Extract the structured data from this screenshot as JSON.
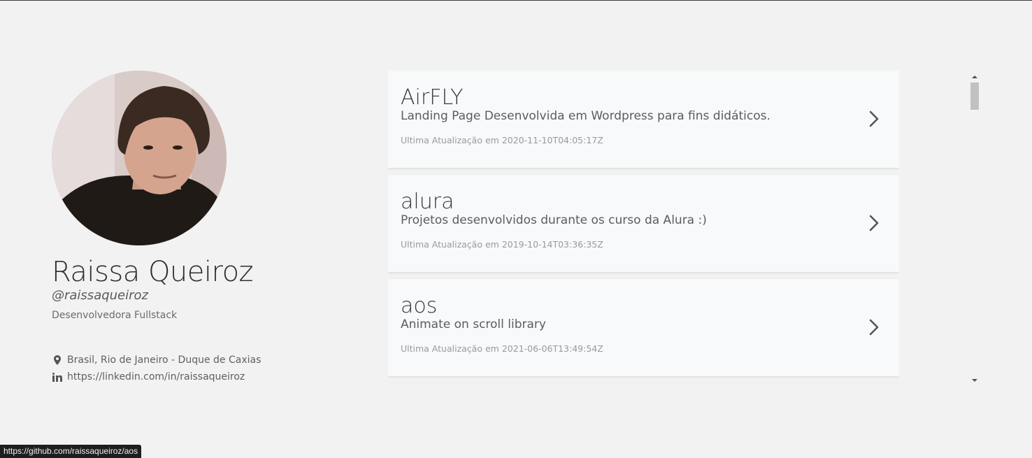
{
  "profile": {
    "name": "Raissa Queiroz",
    "handle": "@raissaqueiroz",
    "role": "Desenvolvedora Fullstack",
    "location": "Brasil, Rio de Janeiro - Duque de Caxias",
    "linkedin": "https://linkedin.com/in/raissaqueiroz",
    "location_icon": "map-marker-icon",
    "linkedin_icon": "linkedin-icon"
  },
  "repos": [
    {
      "title": "AirFLY",
      "description": "Landing Page Desenvolvida em Wordpress para fins didáticos.",
      "updated_label": "Ultima Atualização em",
      "updated_at": "2020-11-10T04:05:17Z"
    },
    {
      "title": "alura",
      "description": "Projetos desenvolvidos durante os curso da Alura :)",
      "updated_label": "Ultima Atualização em",
      "updated_at": "2019-10-14T03:36:35Z"
    },
    {
      "title": "aos",
      "description": "Animate on scroll library",
      "updated_label": "Ultima Atualização em",
      "updated_at": "2021-06-06T13:49:54Z"
    }
  ],
  "status_url": "https://github.com/raissaqueiroz/aos",
  "colors": {
    "background": "#f2f2f2",
    "card": "#f8f9fa",
    "text": "#3c3c3c"
  }
}
